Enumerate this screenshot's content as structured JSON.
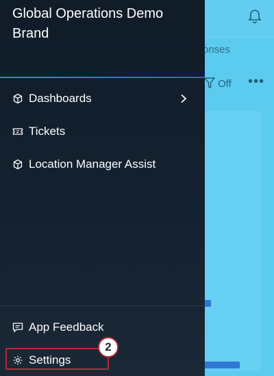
{
  "header": {
    "brand_title": "Global Operations Demo Brand"
  },
  "background": {
    "tab_fragment": "onses",
    "filter_label": "Off",
    "more_glyph": "•••"
  },
  "nav": {
    "items": [
      {
        "label": "Dashboards",
        "icon": "cube-icon",
        "has_chevron": true
      },
      {
        "label": "Tickets",
        "icon": "ticket-icon"
      },
      {
        "label": "Location Manager Assist",
        "icon": "cube-icon"
      }
    ],
    "footer": [
      {
        "label": "App Feedback",
        "icon": "feedback-icon"
      },
      {
        "label": "Settings",
        "icon": "gear-icon"
      }
    ]
  },
  "annotation": {
    "step_number": "2",
    "color": "#b8293b"
  },
  "colors": {
    "drawer_bg": "#101c28",
    "app_bg": "#5ccbf0",
    "accent": "#2e7fbf"
  }
}
